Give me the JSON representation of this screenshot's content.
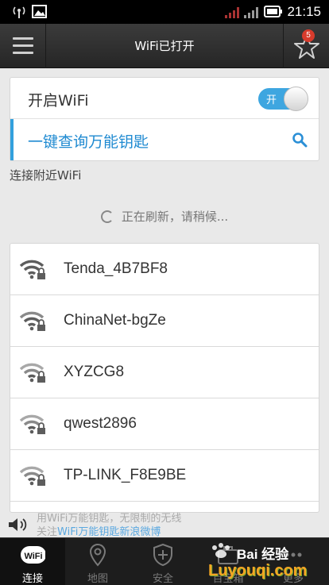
{
  "status_bar": {
    "time": "21:15"
  },
  "header": {
    "title": "WiFi已打开",
    "favorites_badge": "5"
  },
  "wifi_toggle": {
    "label": "开启WiFi",
    "state_label": "开"
  },
  "key_query": {
    "label": "一键查询万能钥匙"
  },
  "nearby": {
    "section_title": "连接附近WiFi",
    "refresh_status": "正在刷新，请稍候..."
  },
  "networks": [
    {
      "ssid": "Tenda_4B7BF8"
    },
    {
      "ssid": "ChinaNet-bgZe"
    },
    {
      "ssid": "XYZCG8"
    },
    {
      "ssid": "qwest2896"
    },
    {
      "ssid": "TP-LINK_F8E9BE"
    }
  ],
  "notice": {
    "line1": "用WiFi万能钥匙，无限制的无线",
    "line2_prefix": "关注",
    "line2_link": "WiFi万能钥匙新浪微博"
  },
  "tabs": [
    {
      "label": "连接",
      "icon_text": "WiFi"
    },
    {
      "label": "地图"
    },
    {
      "label": "安全"
    },
    {
      "label": "百宝箱"
    },
    {
      "label": "更多"
    }
  ],
  "watermark": {
    "text": "Bai 经验",
    "site": "Luyouqi.com"
  },
  "colors": {
    "accent": "#33a0dd",
    "toggle_on": "#3ea6e0",
    "badge": "#d83b2c"
  }
}
